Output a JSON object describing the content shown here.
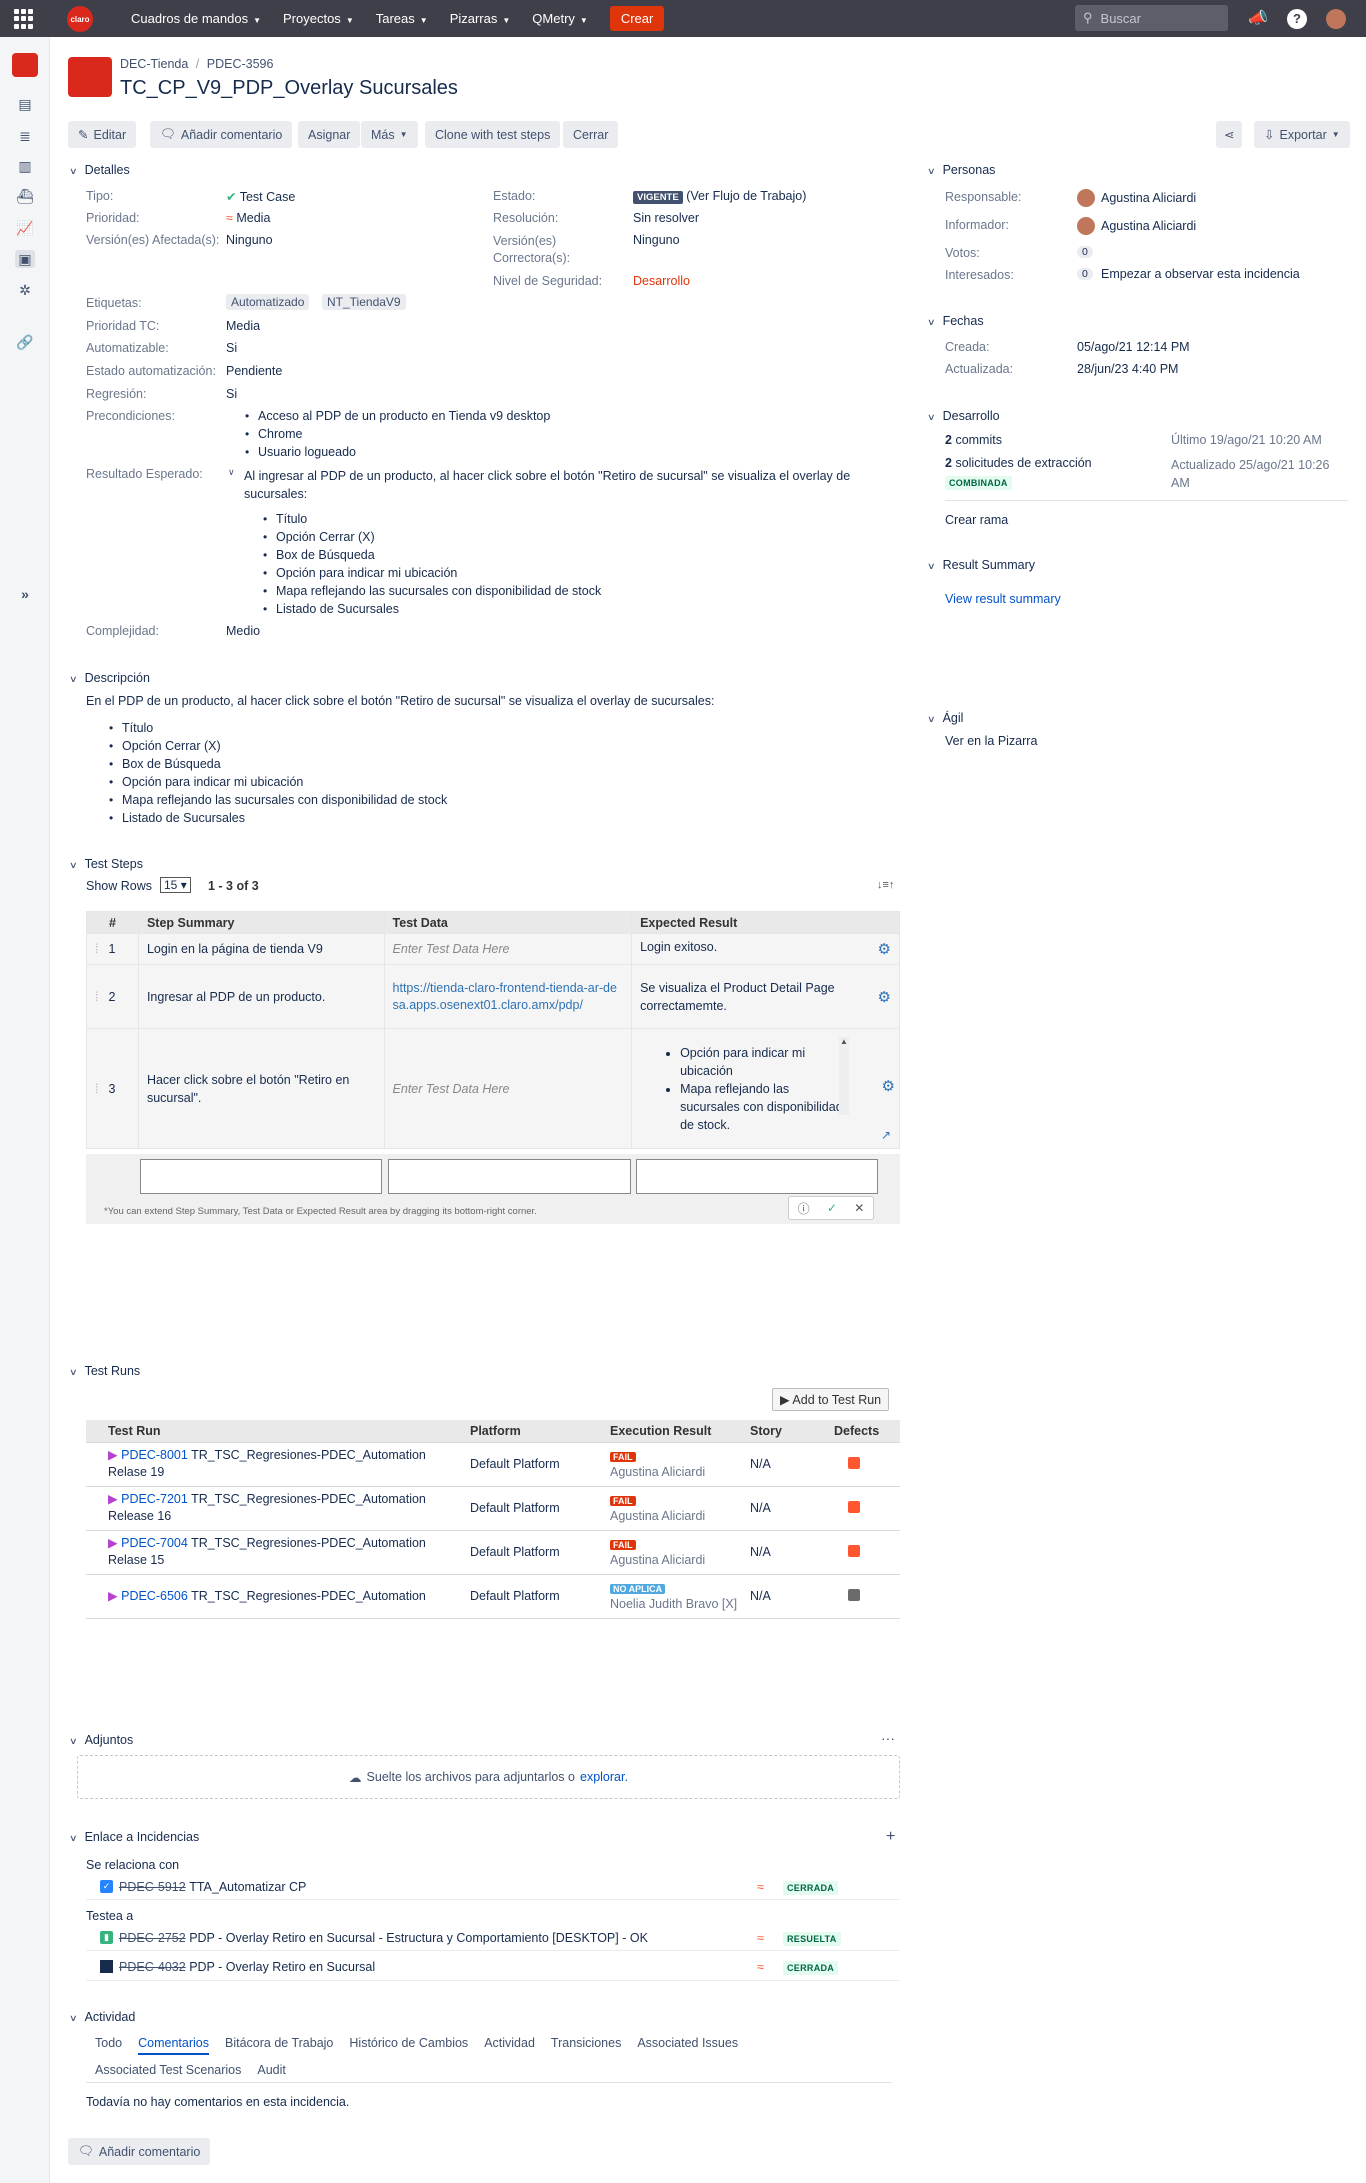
{
  "topbar": {
    "brand": "claro",
    "nav": [
      "Cuadros de mandos",
      "Proyectos",
      "Tareas",
      "Pizarras",
      "QMetry"
    ],
    "create": "Crear",
    "search_placeholder": "Buscar"
  },
  "breadcrumb": {
    "project": "DEC-Tienda",
    "issue": "PDEC-3596"
  },
  "title": "TC_CP_V9_PDP_Overlay Sucursales",
  "toolbar": {
    "edit": "Editar",
    "comment": "Añadir comentario",
    "assign": "Asignar",
    "more": "Más",
    "clone": "Clone with test steps",
    "close": "Cerrar",
    "export": "Exportar"
  },
  "details": {
    "heading": "Detalles",
    "tipo_l": "Tipo:",
    "tipo_v": "Test Case",
    "prioridad_l": "Prioridad:",
    "prioridad_v": "Media",
    "version_l": "Versión(es) Afectada(s):",
    "version_v": "Ninguno",
    "estado_l": "Estado:",
    "estado_badge": "VIGENTE",
    "estado_flow": "(Ver Flujo de Trabajo)",
    "resolucion_l": "Resolución:",
    "resolucion_v": "Sin resolver",
    "correctora_l": "Versión(es) Correctora(s):",
    "correctora_v": "Ninguno",
    "seguridad_l": "Nivel de Seguridad:",
    "seguridad_v": "Desarrollo",
    "etiquetas_l": "Etiquetas:",
    "etiquetas": [
      "Automatizado",
      "NT_TiendaV9"
    ],
    "prioridad_tc_l": "Prioridad TC:",
    "prioridad_tc_v": "Media",
    "automatizable_l": "Automatizable:",
    "automatizable_v": "Si",
    "estado_auto_l": "Estado automatización:",
    "estado_auto_v": "Pendiente",
    "regresion_l": "Regresión:",
    "regresion_v": "Si",
    "precondiciones_l": "Precondiciones:",
    "precondiciones": [
      "Acceso al PDP de un producto en Tienda v9 desktop",
      "Chrome",
      "Usuario logueado"
    ],
    "resultado_l": "Resultado Esperado:",
    "resultado_intro": "Al ingresar al PDP de un producto, al hacer click sobre el botón \"Retiro de sucursal\" se visualiza el overlay de sucursales:",
    "resultado_items": [
      "Título",
      "Opción Cerrar (X)",
      "Box de Búsqueda",
      "Opción para indicar mi ubicación",
      "Mapa reflejando las sucursales con disponibilidad de stock",
      "Listado de Sucursales"
    ],
    "complejidad_l": "Complejidad:",
    "complejidad_v": "Medio"
  },
  "description": {
    "heading": "Descripción",
    "intro": "En el PDP de un producto, al hacer click sobre el botón \"Retiro de sucursal\" se visualiza el overlay de sucursales:",
    "items": [
      "Título",
      "Opción Cerrar (X)",
      "Box de Búsqueda",
      "Opción para indicar mi ubicación",
      "Mapa reflejando las sucursales con disponibilidad de stock",
      "Listado de Sucursales"
    ]
  },
  "test_steps": {
    "heading": "Test Steps",
    "show_rows": "Show Rows",
    "rows_value": "15",
    "range": "1 - 3 of 3",
    "cols": [
      "#",
      "Step Summary",
      "Test Data",
      "Expected Result"
    ],
    "placeholder": "Enter Test Data Here",
    "rows": [
      {
        "n": "1",
        "summary": "Login en la página de tienda V9",
        "data": "",
        "expected": "Login exitoso."
      },
      {
        "n": "2",
        "summary": "Ingresar al PDP de un producto.",
        "data": "https://tienda-claro-frontend-tienda-ar-desa.apps.osenext01.claro.amx/pdp/",
        "expected": "Se visualiza el Product Detail Page correctamemte."
      },
      {
        "n": "3",
        "summary": "Hacer click sobre el botón \"Retiro en sucursal\".",
        "data": "",
        "expected_items": [
          "Opción para indicar mi ubicación",
          "Mapa reflejando las sucursales con disponibilidad de stock."
        ]
      }
    ],
    "hint": "*You can extend Step Summary, Test Data or Expected Result area by dragging its bottom-right corner."
  },
  "test_runs": {
    "heading": "Test Runs",
    "add": "Add to Test Run",
    "cols": [
      "Test Run",
      "Platform",
      "Execution Result",
      "Story",
      "Defects"
    ],
    "rows": [
      {
        "key": "PDEC-8001",
        "name": "TR_TSC_Regresiones-PDEC_Automation Relase 19",
        "platform": "Default Platform",
        "result": "FAIL",
        "user": "Agustina Aliciardi",
        "story": "N/A"
      },
      {
        "key": "PDEC-7201",
        "name": "TR_TSC_Regresiones-PDEC_Automation Release 16",
        "platform": "Default Platform",
        "result": "FAIL",
        "user": "Agustina Aliciardi",
        "story": "N/A"
      },
      {
        "key": "PDEC-7004",
        "name": "TR_TSC_Regresiones-PDEC_Automation Relase 15",
        "platform": "Default Platform",
        "result": "FAIL",
        "user": "Agustina Aliciardi",
        "story": "N/A"
      },
      {
        "key": "PDEC-6506",
        "name": "TR_TSC_Regresiones-PDEC_Automation",
        "platform": "Default Platform",
        "result": "NO APLICA",
        "user": "Noelia Judith Bravo [X]",
        "story": "N/A"
      }
    ]
  },
  "attachments": {
    "heading": "Adjuntos",
    "drop": "Suelte los archivos para adjuntarlos o",
    "browse": "explorar."
  },
  "links": {
    "heading": "Enlace a Incidencias",
    "g1": "Se relaciona con",
    "g1_items": [
      {
        "key": "PDEC-5912",
        "summary": "TTA_Automatizar CP",
        "status": "CERRADA"
      }
    ],
    "g2": "Testea a",
    "g2_items": [
      {
        "key": "PDEC-2752",
        "summary": "PDP - Overlay Retiro en Sucursal - Estructura y Comportamiento [DESKTOP] - OK",
        "status": "RESUELTA"
      },
      {
        "key": "PDEC-4032",
        "summary": "PDP - Overlay Retiro en Sucursal",
        "status": "CERRADA"
      }
    ]
  },
  "activity": {
    "heading": "Actividad",
    "tabs": [
      "Todo",
      "Comentarios",
      "Bitácora de Trabajo",
      "Histórico de Cambios",
      "Actividad",
      "Transiciones",
      "Associated Issues"
    ],
    "tabs2": [
      "Associated Test Scenarios",
      "Audit"
    ],
    "empty": "Todavía no hay comentarios en esta incidencia.",
    "add": "Añadir comentario"
  },
  "people": {
    "heading": "Personas",
    "resp_l": "Responsable:",
    "resp_v": "Agustina Aliciardi",
    "inf_l": "Informador:",
    "inf_v": "Agustina Aliciardi",
    "votes_l": "Votos:",
    "votes_v": "0",
    "watch_l": "Interesados:",
    "watch_v": "0",
    "watch_link": "Empezar a observar esta incidencia"
  },
  "dates": {
    "heading": "Fechas",
    "created_l": "Creada:",
    "created_v": "05/ago/21 12:14 PM",
    "updated_l": "Actualizada:",
    "updated_v": "28/jun/23 4:40 PM"
  },
  "dev": {
    "heading": "Desarrollo",
    "commits_n": "2",
    "commits": "commits",
    "commits_when": "Último 19/ago/21 10:20 AM",
    "pr_n": "2",
    "pr": "solicitudes de extracción",
    "pr_when": "Actualizado 25/ago/21 10:26 AM",
    "pr_badge": "COMBINADA",
    "branch": "Crear rama"
  },
  "result_summary": {
    "heading": "Result Summary",
    "link": "View result summary"
  },
  "agile": {
    "heading": "Ágil",
    "link": "Ver en la Pizarra"
  }
}
